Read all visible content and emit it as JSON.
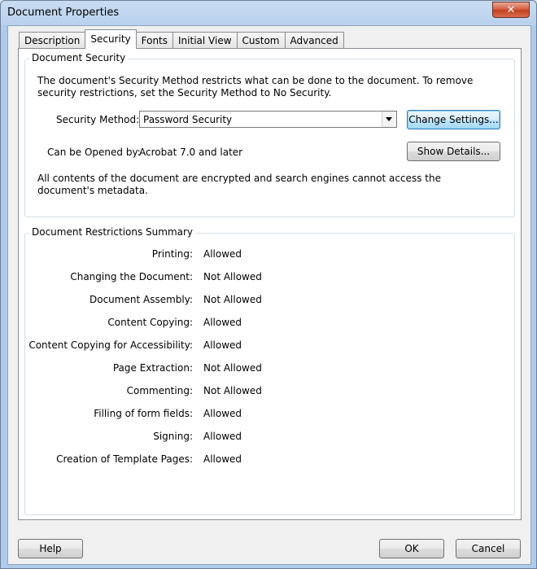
{
  "window": {
    "title": "Document Properties",
    "close_glyph": "✕"
  },
  "tabs": [
    {
      "label": "Description"
    },
    {
      "label": "Security"
    },
    {
      "label": "Fonts"
    },
    {
      "label": "Initial View"
    },
    {
      "label": "Custom"
    },
    {
      "label": "Advanced"
    }
  ],
  "active_tab": "Security",
  "security_group": {
    "legend": "Document Security",
    "description": "The document's Security Method restricts what can be done to the document. To remove security restrictions, set the Security Method to No Security.",
    "method_label": "Security Method:",
    "method_value": "Password Security",
    "change_settings_label": "Change Settings...",
    "opened_by_label": "Can be Opened by:",
    "opened_by_value": "Acrobat 7.0 and later",
    "show_details_label": "Show Details...",
    "encryption_note": "All contents of the document are encrypted and search engines cannot access the document's metadata."
  },
  "restrictions_group": {
    "legend": "Document Restrictions Summary",
    "rows": [
      {
        "label": "Printing:",
        "value": "Allowed"
      },
      {
        "label": "Changing the Document:",
        "value": "Not Allowed"
      },
      {
        "label": "Document Assembly:",
        "value": "Not Allowed"
      },
      {
        "label": "Content Copying:",
        "value": "Allowed"
      },
      {
        "label": "Content Copying for Accessibility:",
        "value": "Allowed"
      },
      {
        "label": "Page Extraction:",
        "value": "Not Allowed"
      },
      {
        "label": "Commenting:",
        "value": "Not Allowed"
      },
      {
        "label": "Filling of form fields:",
        "value": "Allowed"
      },
      {
        "label": "Signing:",
        "value": "Allowed"
      },
      {
        "label": "Creation of Template Pages:",
        "value": "Allowed"
      }
    ]
  },
  "footer": {
    "help_label": "Help",
    "ok_label": "OK",
    "cancel_label": "Cancel"
  }
}
